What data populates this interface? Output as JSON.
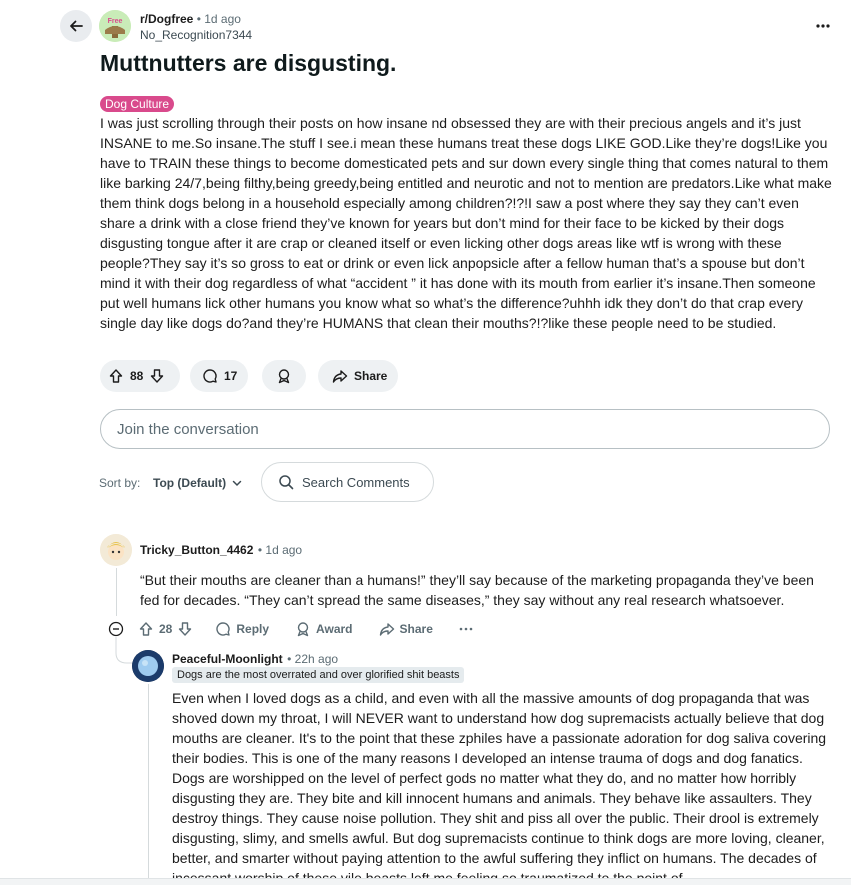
{
  "post": {
    "subreddit": "r/Dogfree",
    "subreddit_icon_text": "Dog Free",
    "time": "1d ago",
    "author": "No_Recognition7344",
    "title": "Muttnutters are disgusting.",
    "flair": "Dog Culture",
    "body": "I was just scrolling through their posts on how insane nd obsessed they are with their precious angels and it’s just INSANE to me.So insane.The stuff I see.i mean these humans treat these dogs LIKE GOD.Like they’re dogs!Like you have to TRAIN these things to become domesticated pets and sur down every single thing that comes natural to them like barking 24/7,being filthy,being greedy,being entitled and neurotic and not to mention are predators.Like what make them think dogs belong in a household especially among children?!?!I saw a post where they say they can’t even share a drink with a close friend they’ve known for years but don’t mind for their face to be kicked by their dogs disgusting tongue after it are crap or cleaned itself or even licking other dogs areas like wtf is wrong with these people?They say it’s so gross to eat or drink or even lick anpopsicle after a fellow human that’s a spouse but don’t mind it with their dog regardless of what “accident ” it has done with its mouth from earlier it’s insane.Then someone put well humans lick other humans you know what so what’s the difference?uhhh idk they don’t do that crap every single day like dogs do?and they’re HUMANS that clean their mouths?!?like these people need to be studied.",
    "votes": "88",
    "comments": "17",
    "share_label": "Share"
  },
  "join_placeholder": "Join the conversation",
  "sort": {
    "label": "Sort by:",
    "value": "Top (Default)"
  },
  "search_comments": "Search Comments",
  "comments": [
    {
      "user": "Tricky_Button_4462",
      "time": "1d ago",
      "text": "“But their mouths are cleaner than a humans!” they’ll say because of the marketing propaganda they’ve been fed for decades. “They can’t spread the same diseases,” they say without any real research whatsoever.",
      "votes": "28",
      "reply_label": "Reply",
      "award_label": "Award",
      "share_label": "Share"
    },
    {
      "user": "Peaceful-Moonlight",
      "time": "22h ago",
      "user_flair": "Dogs are the most overrated and over glorified shit beasts",
      "text": "Even when I loved dogs as a child, and even with all the massive amounts of dog propaganda that was shoved down my throat, I will NEVER want to understand how dog supremacists actually believe that dog mouths are cleaner. It's to the point that these zphiles have a passionate adoration for dog saliva covering their bodies. This is one of the many reasons I developed an intense trauma of dogs and dog fanatics. Dogs are worshipped on the level of perfect gods no matter what they do, and no matter how horribly disgusting they are. They bite and kill innocent humans and animals. They behave like assaulters. They destroy things. They cause noise pollution. They shit and piss all over the public. Their drool is extremely disgusting, slimy, and smells awful. But dog supremacists continue to think dogs are more loving, cleaner, better, and smarter without paying attention to the awful suffering they inflict on humans. The decades of incessant worship of these vile beasts left me feeling so traumatized to the point of"
    }
  ]
}
